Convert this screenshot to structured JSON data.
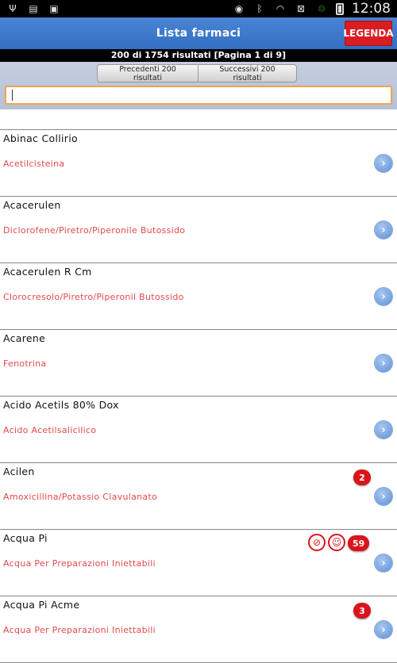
{
  "statusbar": {
    "time": "12:08",
    "left_icons": [
      "usb-icon",
      "sd-card-icon",
      "image-icon"
    ],
    "right_icons": [
      "eye-icon",
      "bluetooth-icon",
      "wifi-icon",
      "no-sim-icon",
      "recycle-icon",
      "battery-icon"
    ]
  },
  "header": {
    "title": "Lista farmaci",
    "legend_label": "LEGENDA"
  },
  "results": {
    "text": "200 di 1754 risultati [Pagina 1 di 9]"
  },
  "nav": {
    "prev_label": "Precedenti 200 risultati",
    "next_label": "Successivi 200 risultati"
  },
  "search": {
    "value": "",
    "placeholder": ""
  },
  "list": [
    {
      "name": "Abinac Collirio",
      "substance": "Acetilcisteina"
    },
    {
      "name": "Acacerulen",
      "substance": "Diclorofene/Piretro/Piperonile Butossido"
    },
    {
      "name": "Acacerulen R Cm",
      "substance": "Clorocresolo/Piretro/Piperonil Butossido"
    },
    {
      "name": "Acarene",
      "substance": "Fenotrina"
    },
    {
      "name": "Acido Acetils 80% Dox",
      "substance": "Acido Acetilsalicilico"
    },
    {
      "name": "Acilen",
      "substance": "Amoxicillina/Potassio Clavulanato",
      "badge": "2"
    },
    {
      "name": "Acqua Pi",
      "substance": "Acqua Per Preparazioni Iniettabili",
      "badge": "59",
      "icons": [
        "no-spray-icon",
        "smiley-icon"
      ]
    },
    {
      "name": "Acqua Pi Acme",
      "substance": "Acqua Per Preparazioni Iniettabili",
      "badge": "3"
    }
  ],
  "colors": {
    "header": "#3f7bcc",
    "legend": "#d91d23",
    "substance_text": "#e24a4a",
    "badge": "#d9141a"
  }
}
